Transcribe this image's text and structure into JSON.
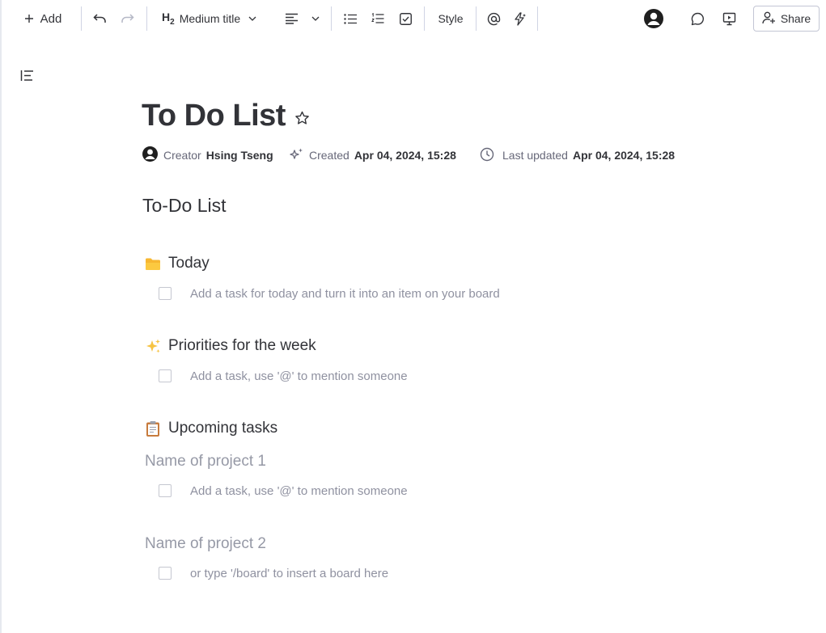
{
  "toolbar": {
    "add_label": "Add",
    "heading_level": "H",
    "heading_sub": "2",
    "block_type": "Medium title",
    "style_label": "Style",
    "share_label": "Share"
  },
  "doc": {
    "title": "To Do List",
    "meta": {
      "creator_label": "Creator",
      "creator_name": "Hsing Tseng",
      "created_label": "Created",
      "created_value": "Apr 04, 2024, 15:28",
      "updated_label": "Last updated",
      "updated_value": "Apr 04, 2024, 15:28"
    },
    "heading": "To-Do List",
    "sections": {
      "today": {
        "emoji": "📁",
        "title": "Today",
        "task": "Add a task for today and turn it into an item on your board"
      },
      "week": {
        "emoji": "✨",
        "title": "Priorities for the week",
        "task": "Add a task, use '@' to mention someone"
      },
      "upcoming": {
        "emoji": "📋",
        "title": "Upcoming tasks"
      }
    },
    "projects": [
      {
        "title": "Name of project 1",
        "task": "Add a task, use '@' to mention someone"
      },
      {
        "title": "Name of project 2",
        "task": "or type '/board' to insert a board here"
      }
    ]
  },
  "colors": {
    "text": "#323338",
    "muted": "#8f91a0",
    "folder": "#f7b731",
    "sparkle": "#f6c343"
  }
}
